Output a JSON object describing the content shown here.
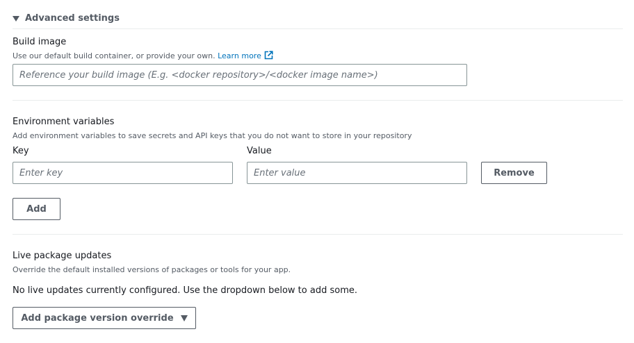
{
  "advanced": {
    "title": "Advanced settings"
  },
  "build_image": {
    "label": "Build image",
    "description": "Use our default build container, or provide your own.",
    "learn_more": "Learn more",
    "placeholder": "Reference your build image (E.g. <docker repository>/<docker image name>)",
    "value": ""
  },
  "env_vars": {
    "label": "Environment variables",
    "description": "Add environment variables to save secrets and API keys that you do not want to store in your repository",
    "key_header": "Key",
    "value_header": "Value",
    "key_placeholder": "Enter key",
    "value_placeholder": "Enter value",
    "remove_label": "Remove",
    "add_label": "Add"
  },
  "live_updates": {
    "label": "Live package updates",
    "description": "Override the default installed versions of packages or tools for your app.",
    "message": "No live updates currently configured. Use the dropdown below to add some.",
    "dropdown_label": "Add package version override"
  },
  "icons": {
    "toggle": "caret-down-icon",
    "external_link": "external-link-icon",
    "dropdown": "caret-down-icon"
  },
  "colors": {
    "link": "#0073bb",
    "border": "#879596",
    "text": "#16191f",
    "muted": "#545b64",
    "divider": "#eaeded"
  }
}
